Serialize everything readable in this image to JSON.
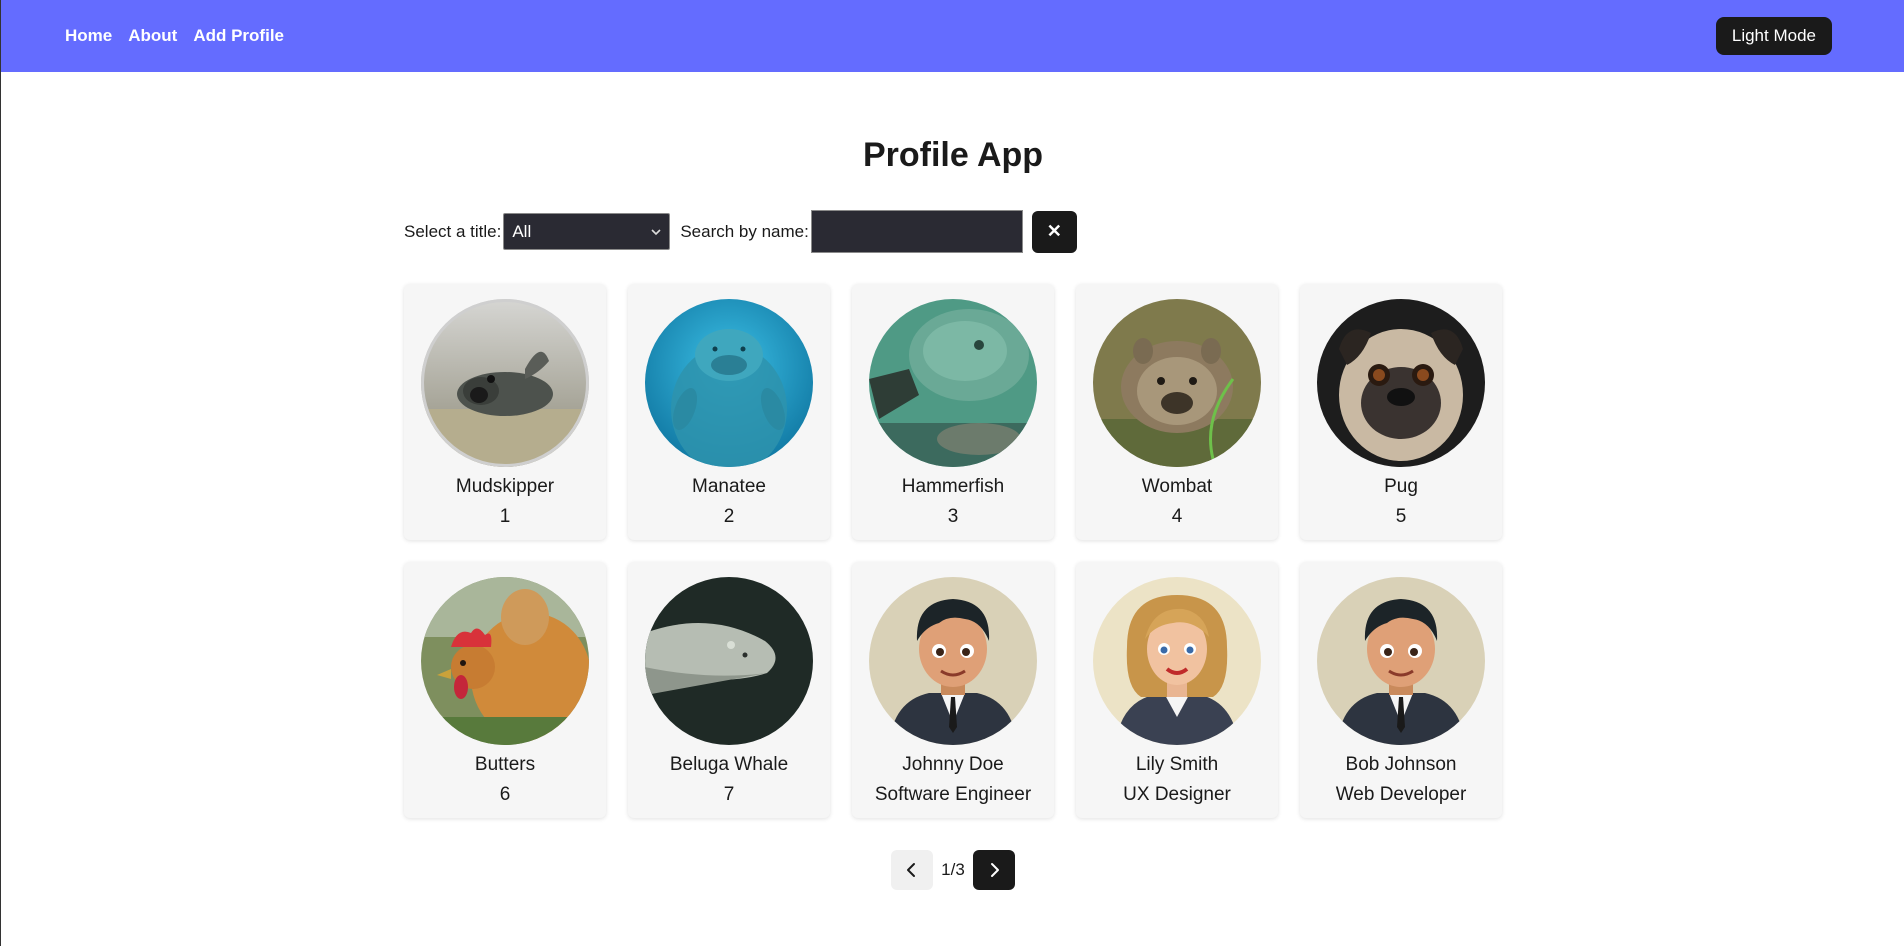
{
  "nav": {
    "links": [
      "Home",
      "About",
      "Add Profile"
    ],
    "mode_button": "Light Mode"
  },
  "page": {
    "title": "Profile App"
  },
  "filters": {
    "title_label": "Select a title:",
    "title_value": "All",
    "search_label": "Search by name:",
    "search_value": "",
    "clear_label": "✕"
  },
  "profiles": [
    {
      "name": "Mudskipper",
      "sub": "1",
      "photo": "mudskipper"
    },
    {
      "name": "Manatee",
      "sub": "2",
      "photo": "manatee"
    },
    {
      "name": "Hammerfish",
      "sub": "3",
      "photo": "hammerfish"
    },
    {
      "name": "Wombat",
      "sub": "4",
      "photo": "wombat"
    },
    {
      "name": "Pug",
      "sub": "5",
      "photo": "pug"
    },
    {
      "name": "Butters",
      "sub": "6",
      "photo": "chicken"
    },
    {
      "name": "Beluga Whale",
      "sub": "7",
      "photo": "beluga"
    },
    {
      "name": "Johnny Doe",
      "sub": "Software Engineer",
      "photo": "cartoon-man"
    },
    {
      "name": "Lily Smith",
      "sub": "UX Designer",
      "photo": "cartoon-woman"
    },
    {
      "name": "Bob Johnson",
      "sub": "Web Developer",
      "photo": "cartoon-man"
    }
  ],
  "pagination": {
    "indicator": "1/3"
  },
  "colors": {
    "navbar": "#646cff",
    "button_dark": "#1a1a1a",
    "input_bg": "#2a2a33"
  }
}
